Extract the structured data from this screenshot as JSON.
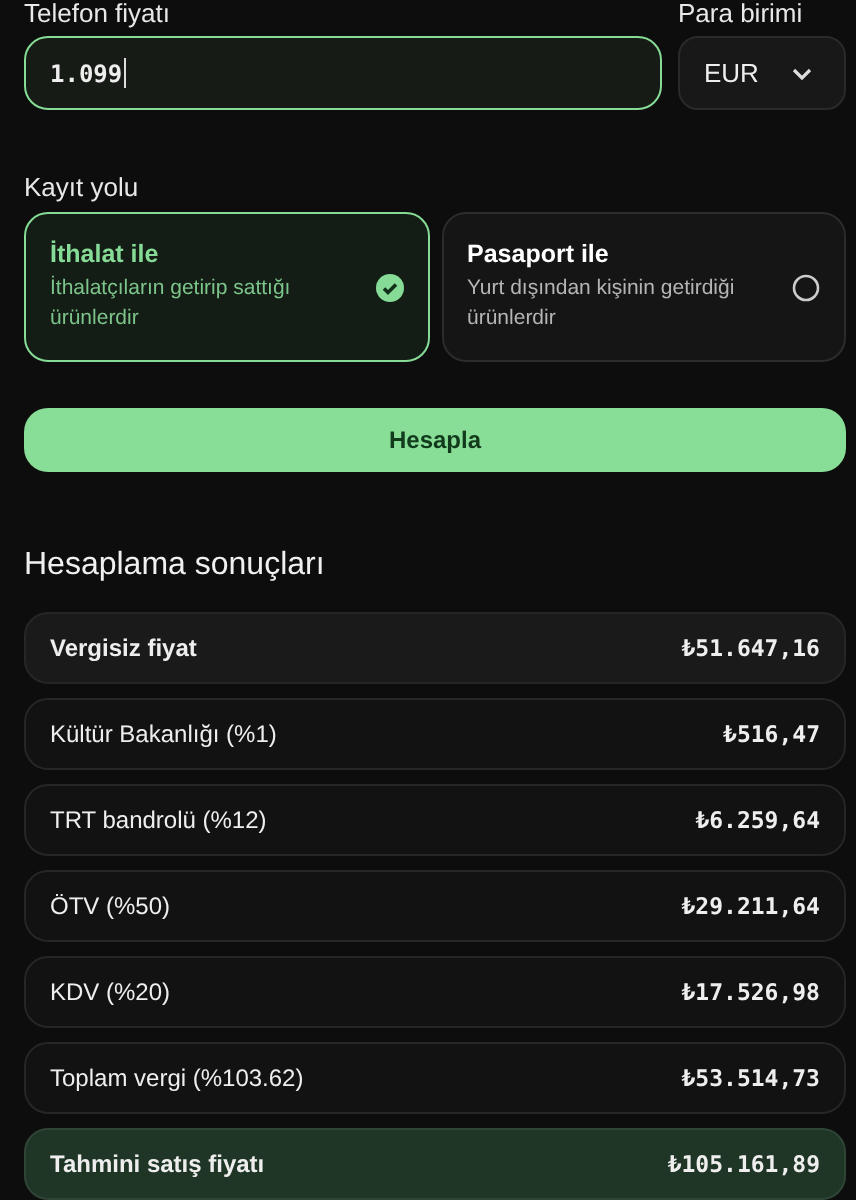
{
  "price": {
    "label": "Telefon fiyatı",
    "value": "1.099"
  },
  "currency": {
    "label": "Para birimi",
    "value": "EUR"
  },
  "route": {
    "label": "Kayıt yolu",
    "options": [
      {
        "title": "İthalat ile",
        "description": "İthalatçıların getirip sattığı ürünlerdir",
        "selected": true
      },
      {
        "title": "Pasaport ile",
        "description": "Yurt dışından kişinin getirdiği ürünlerdir",
        "selected": false
      }
    ]
  },
  "calculate_button": "Hesapla",
  "results": {
    "title": "Hesaplama sonuçları",
    "rows": [
      {
        "kind": "emphasis",
        "label": "Vergisiz fiyat",
        "value": "₺51.647,16"
      },
      {
        "kind": "normal",
        "label": "Kültür Bakanlığı (%1)",
        "value": "₺516,47"
      },
      {
        "kind": "normal",
        "label": "TRT bandrolü (%12)",
        "value": "₺6.259,64"
      },
      {
        "kind": "normal",
        "label": "ÖTV (%50)",
        "value": "₺29.211,64"
      },
      {
        "kind": "normal",
        "label": "KDV (%20)",
        "value": "₺17.526,98"
      },
      {
        "kind": "normal",
        "label": "Toplam vergi (%103.62)",
        "value": "₺53.514,73"
      },
      {
        "kind": "total",
        "label": "Tahmini satış fiyatı",
        "value": "₺105.161,89"
      }
    ]
  }
}
